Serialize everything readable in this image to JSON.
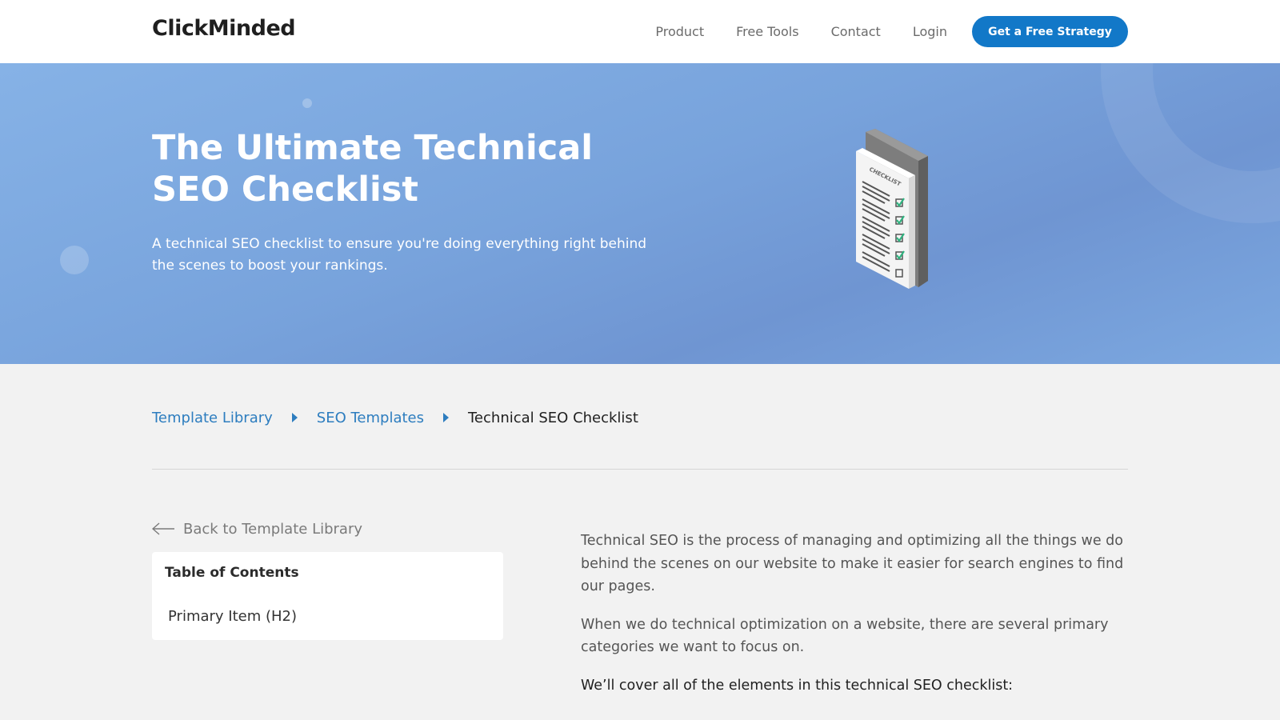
{
  "header": {
    "logo": "ClickMinded",
    "nav": [
      "Product",
      "Free Tools",
      "Contact",
      "Login"
    ],
    "cta_label": "Get a Free Strategy"
  },
  "hero": {
    "title": "The Ultimate Technical SEO Checklist",
    "subtitle": "A technical SEO checklist to ensure you're doing everything right behind the scenes to boost your rankings.",
    "illustration_label": "CHECKLIST",
    "illustration_icon": "checklist-phone-icon"
  },
  "breadcrumb": {
    "items": [
      "Template Library",
      "SEO Templates"
    ],
    "current": "Technical SEO Checklist",
    "separator_icon": "caret-right-icon"
  },
  "sidebar": {
    "back_label": "Back to Template Library",
    "back_icon": "arrow-left-icon",
    "toc_title": "Table of Contents",
    "toc_items": [
      "Primary Item (H2)"
    ]
  },
  "article": {
    "paragraphs": [
      "Technical SEO is the process of managing and optimizing all the things we do behind the scenes on our website to make it easier for search engines to find our pages.",
      "When we do technical optimization on a website, there are several primary categories we want to focus on.",
      "We’ll cover all of the elements in this technical SEO checklist:"
    ]
  },
  "colors": {
    "accent": "#1278c8",
    "link": "#2d7dbf",
    "hero_bg": "#7ca8e0",
    "check_green": "#2fb37f"
  }
}
